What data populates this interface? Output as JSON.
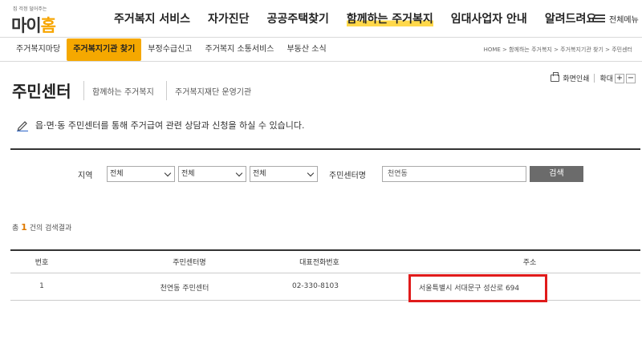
{
  "header": {
    "logo_tagline": "집 걱정 덜어주는",
    "logo_text_left": "마이",
    "logo_text_accent": "홈",
    "menu": [
      {
        "label": "주거복지 서비스",
        "active": false
      },
      {
        "label": "자가진단",
        "active": false
      },
      {
        "label": "공공주택찾기",
        "active": false
      },
      {
        "label": "함께하는 주거복지",
        "active": true
      },
      {
        "label": "임대사업자 안내",
        "active": false
      },
      {
        "label": "알려드려요",
        "active": false
      }
    ],
    "all_menu_label": "전체메뉴",
    "accent_color": "#f5a800"
  },
  "subnav": {
    "items": [
      {
        "label": "주거복지마당",
        "active": false
      },
      {
        "label": "주거복지기관 찾기",
        "active": true
      },
      {
        "label": "부정수급신고",
        "active": false
      },
      {
        "label": "주거복지 소통서비스",
        "active": false
      },
      {
        "label": "부동산 소식",
        "active": false
      }
    ],
    "breadcrumb": "HOME > 함께하는 주거복지 > 주거복지기관 찾기 > 주민센터"
  },
  "page": {
    "title": "주민센터",
    "sub_links": [
      "함께하는 주거복지",
      "주거복지재단 운영기관"
    ],
    "print_label": "화면인쇄",
    "zoom_label": "확대",
    "zoom_in": "+",
    "zoom_out": "−",
    "notice": "읍·면·동 주민센터를 통해 주거급여 관련 상담과 신청을 하실 수 있습니다."
  },
  "search": {
    "region_label": "지역",
    "region_selects": [
      "전체",
      "전체",
      "전체"
    ],
    "center_label": "주민센터명",
    "center_value": "천연동",
    "button_label": "검색"
  },
  "results": {
    "prefix": "총",
    "count": "1",
    "suffix": "건의 검색결과",
    "headers": [
      "번호",
      "주민센터명",
      "대표전화번호",
      "주소"
    ],
    "rows": [
      {
        "no": "1",
        "name": "천연동 주민센터",
        "phone": "02-330-8103",
        "address": "서울특별시 서대문구 성산로 694"
      }
    ],
    "highlight_color": "#e01b1b"
  }
}
